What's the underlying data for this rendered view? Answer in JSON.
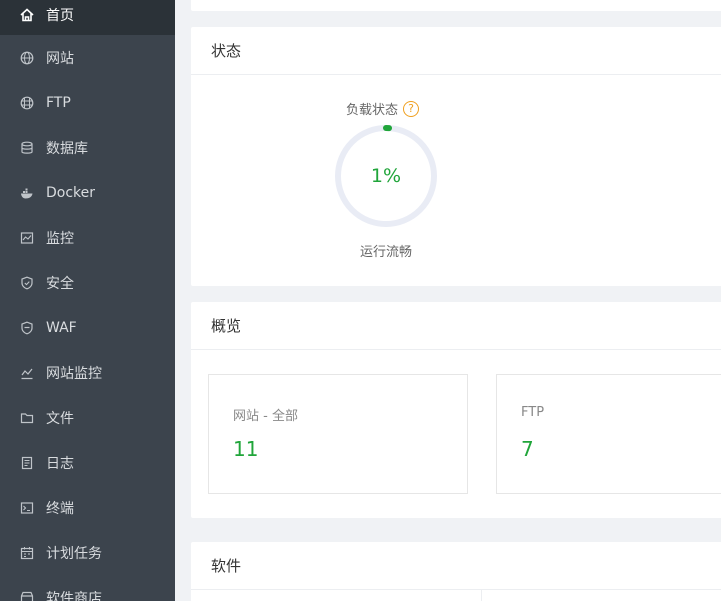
{
  "sidebar": {
    "items": [
      {
        "label": "首页",
        "icon": "home-icon",
        "active": true
      },
      {
        "label": "网站",
        "icon": "globe-icon"
      },
      {
        "label": "FTP",
        "icon": "globe-icon"
      },
      {
        "label": "数据库",
        "icon": "database-icon"
      },
      {
        "label": "Docker",
        "icon": "docker-icon"
      },
      {
        "label": "监控",
        "icon": "monitor-icon"
      },
      {
        "label": "安全",
        "icon": "shield-icon"
      },
      {
        "label": "WAF",
        "icon": "waf-shield-icon"
      },
      {
        "label": "网站监控",
        "icon": "chart-icon"
      },
      {
        "label": "文件",
        "icon": "folder-icon"
      },
      {
        "label": "日志",
        "icon": "log-icon"
      },
      {
        "label": "终端",
        "icon": "terminal-icon"
      },
      {
        "label": "计划任务",
        "icon": "calendar-icon"
      },
      {
        "label": "软件商店",
        "icon": "store-icon"
      }
    ]
  },
  "status": {
    "title": "状态",
    "load_label": "负载状态",
    "help_glyph": "?",
    "load_value": "1%",
    "load_fraction": 0.01,
    "load_text": "运行流畅",
    "accent": "#20a53a"
  },
  "overview": {
    "title": "概览",
    "boxes": [
      {
        "title": "网站 - 全部",
        "value": "11"
      },
      {
        "title": "FTP",
        "value": "7"
      }
    ]
  },
  "software": {
    "title": "软件"
  }
}
